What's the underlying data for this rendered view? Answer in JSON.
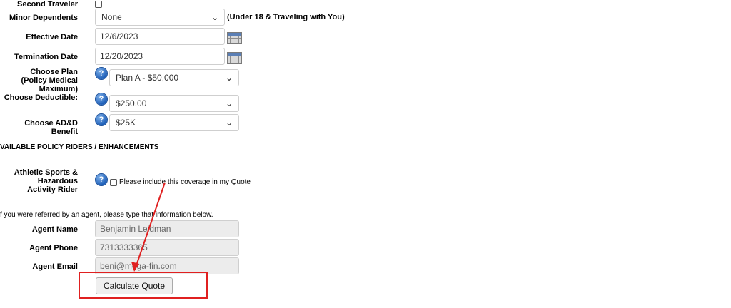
{
  "form": {
    "second_traveler": {
      "label": "Second Traveler",
      "checked": false
    },
    "minor_dependents": {
      "label": "Minor Dependents",
      "value": "None",
      "note": "(Under 18 & Traveling with You)"
    },
    "effective_date": {
      "label": "Effective Date",
      "value": "12/6/2023"
    },
    "termination_date": {
      "label": "Termination Date",
      "value": "12/20/2023"
    },
    "choose_plan": {
      "label_lines": [
        "Choose Plan",
        "(Policy Medical",
        "Maximum)"
      ],
      "value": "Plan A - $50,000"
    },
    "choose_deductible": {
      "label": "Choose Deductible:",
      "value": "$250.00"
    },
    "choose_add": {
      "label": "Choose AD&D Benefit",
      "value": "$25K"
    }
  },
  "riders": {
    "heading": "VAILABLE POLICY RIDERS / ENHANCEMENTS",
    "athletic": {
      "label_lines": [
        "Athletic Sports &",
        "Hazardous",
        "Activity Rider"
      ],
      "checkbox_text": "Please include this coverage in my Quote"
    }
  },
  "agent": {
    "intro": "f you were referred by an agent, please type that information below.",
    "name": {
      "label": "Agent Name",
      "value": "Benjamin Leidman"
    },
    "phone": {
      "label": "Agent Phone",
      "value": "7313333365"
    },
    "email": {
      "label": "Agent Email",
      "value": "beni@mega-fin.com"
    }
  },
  "actions": {
    "calculate_label": "Calculate Quote"
  },
  "icons": {
    "help": "?",
    "dropdown": "⌄"
  },
  "colors": {
    "annotation": "#e02020",
    "help_icon": "#1e5fb8"
  }
}
